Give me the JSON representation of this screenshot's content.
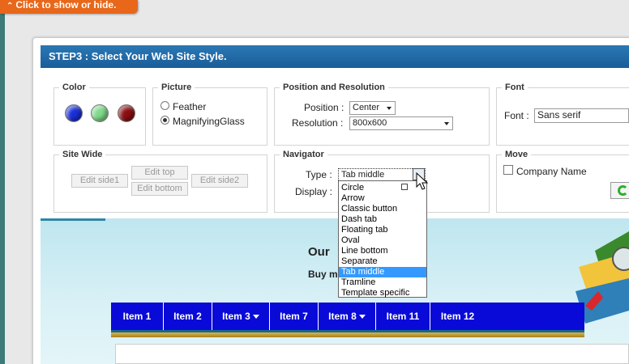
{
  "hide_tab": {
    "label": "Click to show or hide.",
    "icon": "double-chevron-up-icon"
  },
  "dialog": {
    "title": "STEP3 : Select Your Web Site Style."
  },
  "color": {
    "legend": "Color",
    "swatches": [
      {
        "name": "blue",
        "hex": "#1a2fd6"
      },
      {
        "name": "green",
        "hex": "#7fd98a"
      },
      {
        "name": "dark-red",
        "hex": "#8a0f12"
      }
    ]
  },
  "picture": {
    "legend": "Picture",
    "options": [
      {
        "label": "Feather",
        "selected": false
      },
      {
        "label": "MagnifyingGlass",
        "selected": true
      }
    ]
  },
  "position": {
    "legend": "Position and Resolution",
    "position_label": "Position :",
    "position_value": "Center",
    "resolution_label": "Resolution :",
    "resolution_value": "800x600"
  },
  "font": {
    "legend": "Font",
    "label": "Font :",
    "value": "Sans serif"
  },
  "site_wide": {
    "legend": "Site Wide",
    "buttons": {
      "side1": "Edit side1",
      "top": "Edit top",
      "bottom": "Edit bottom",
      "side2": "Edit side2"
    }
  },
  "navigator": {
    "legend": "Navigator",
    "type_label": "Type :",
    "type_value": "Tab middle",
    "display_label": "Display :",
    "options": [
      "Circle",
      "Arrow",
      "Classic button",
      "Dash tab",
      "Floating tab",
      "Oval",
      "Line bottom",
      "Separate",
      "Tab middle",
      "Tramline",
      "Template specific"
    ],
    "selected_index": 8
  },
  "move": {
    "legend": "Move",
    "company_label": "Company Name",
    "checked": false
  },
  "preview": {
    "heading": "Our",
    "subheading": "Buy m",
    "nav_items": [
      {
        "label": "Item 1",
        "has_submenu": false
      },
      {
        "label": "Item 2",
        "has_submenu": false
      },
      {
        "label": "Item 3",
        "has_submenu": true
      },
      {
        "label": "Item 7",
        "has_submenu": false
      },
      {
        "label": "Item 8",
        "has_submenu": true
      },
      {
        "label": "Item 11",
        "has_submenu": false
      },
      {
        "label": "Item 12",
        "has_submenu": false
      }
    ]
  },
  "colors": {
    "title_bar": "#1f6aa6",
    "nav_bar": "#0a0ad8",
    "accent_orange": "#e8671a"
  }
}
